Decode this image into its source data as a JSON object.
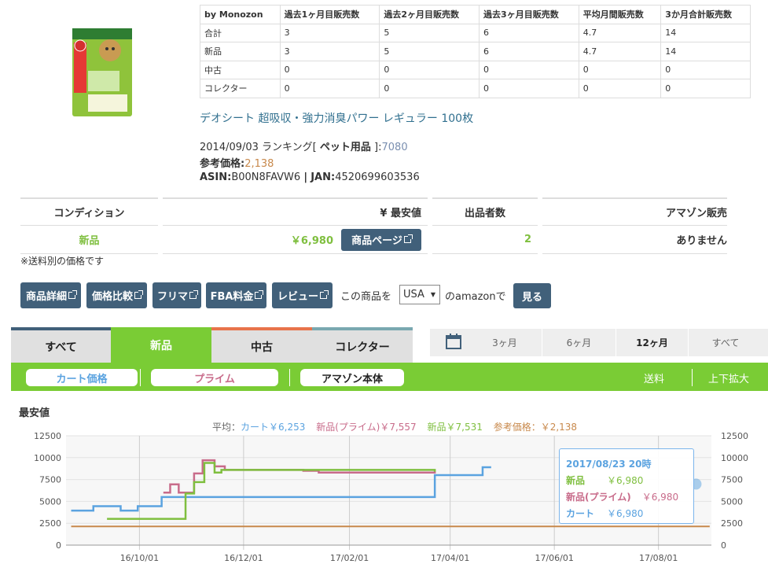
{
  "sales_table": {
    "headers": [
      "by Monozon",
      "過去1ヶ月目販売数",
      "過去2ヶ月目販売数",
      "過去3ヶ月目販売数",
      "平均月間販売数",
      "3か月合計販売数"
    ],
    "rows": [
      [
        "合計",
        "3",
        "5",
        "6",
        "4.7",
        "14"
      ],
      [
        "新品",
        "3",
        "5",
        "6",
        "4.7",
        "14"
      ],
      [
        "中古",
        "0",
        "0",
        "0",
        "0",
        "0"
      ],
      [
        "コレクター",
        "0",
        "0",
        "0",
        "0",
        "0"
      ]
    ]
  },
  "product": {
    "title": "デオシート 超吸収・強力消臭パワー レギュラー 100枚",
    "rank_date": "2014/09/03 ランキング[",
    "rank_category": "ペット用品",
    "rank_close": "]:",
    "rank_value": "7080",
    "ref_price_label": "参考価格:",
    "ref_price": "2,138",
    "asin_label": "ASIN:",
    "asin": "B00N8FAVW6",
    "divider": "|",
    "jan_label": "JAN:",
    "jan": "4520699603536"
  },
  "conditions": {
    "headers": [
      "コンディション",
      "¥ 最安値",
      "出品者数",
      "アマゾン販売"
    ],
    "row": {
      "condition": "新品",
      "price": "￥6,980",
      "page_button": "商品ページ",
      "sellers": "2",
      "amazon": "ありません"
    },
    "note": "※送料別の価格です"
  },
  "actions": {
    "buttons": [
      "商品詳細",
      "価格比較",
      "フリマ",
      "FBA料金",
      "レビュー"
    ],
    "amazon_prefix": "この商品を",
    "country": "USA",
    "amazon_suffix": "のamazonで",
    "view_button": "見る"
  },
  "tabs": [
    "すべて",
    "新品",
    "中古",
    "コレクター"
  ],
  "periods": [
    "3ヶ月",
    "6ヶ月",
    "12ヶ月",
    "すべて"
  ],
  "filters": {
    "cart": "カート価格",
    "prime": "プライム",
    "amazon": "アマゾン本体",
    "shipping": "送料",
    "zoom": "上下拡大"
  },
  "chart_title": "最安値",
  "averages": {
    "label": "平均：",
    "cart": "カート￥6,253",
    "prime": "新品(プライム)￥7,557",
    "new": "新品￥7,531",
    "ref": "参考価格：￥2,138"
  },
  "tooltip": {
    "date": "2017/08/23 20時",
    "new_label": "新品",
    "new_value": "￥6,980",
    "prime_label": "新品(プライム)",
    "prime_value": "￥6,980",
    "cart_label": "カート",
    "cart_value": "￥6,980"
  },
  "colors": {
    "accent": "#41607a",
    "green": "#7acc35",
    "cart": "#5ba3e0",
    "prime": "#c86b8a",
    "new": "#7fbf3f",
    "ref": "#c8894c"
  },
  "chart_data": {
    "type": "line",
    "title": "最安値",
    "ylim": [
      0,
      12500
    ],
    "yticks": [
      "0",
      "2500",
      "5000",
      "7500",
      "10000",
      "12500"
    ],
    "xticks": [
      "16/10/01",
      "16/12/01",
      "17/02/01",
      "17/04/01",
      "17/06/01",
      "17/08/01"
    ],
    "series": [
      {
        "name": "カート",
        "color": "#5ba3e0",
        "points": [
          [
            "2016-08-22",
            3950
          ],
          [
            "2016-09-04",
            4450
          ],
          [
            "2016-09-20",
            3950
          ],
          [
            "2016-09-30",
            4450
          ],
          [
            "2016-10-06",
            4450
          ],
          [
            "2016-10-14",
            5500
          ],
          [
            "2017-03-23",
            8000
          ],
          [
            "2017-04-01",
            8000
          ],
          [
            "2017-04-20",
            8900
          ],
          [
            "2017-04-25",
            8900
          ]
        ]
      },
      {
        "name": "新品(プライム)",
        "color": "#c86b8a",
        "points": [
          [
            "2016-10-15",
            6000
          ],
          [
            "2016-10-19",
            6950
          ],
          [
            "2016-10-24",
            6000
          ],
          [
            "2016-11-02",
            8200
          ],
          [
            "2016-11-07",
            9700
          ],
          [
            "2016-11-14",
            9000
          ],
          [
            "2016-11-20",
            8600
          ],
          [
            "2017-01-05",
            8500
          ],
          [
            "2017-01-14",
            8300
          ],
          [
            "2017-03-23",
            8500
          ]
        ]
      },
      {
        "name": "新品",
        "color": "#7fbf3f",
        "points": [
          [
            "2016-09-12",
            3000
          ],
          [
            "2016-10-28",
            5900
          ],
          [
            "2016-11-02",
            7200
          ],
          [
            "2016-11-08",
            9400
          ],
          [
            "2016-11-14",
            8300
          ],
          [
            "2016-11-18",
            8600
          ],
          [
            "2017-03-23",
            8400
          ]
        ]
      },
      {
        "name": "参考価格",
        "color": "#c8894c",
        "points": [
          [
            "2016-08-22",
            2138
          ],
          [
            "2017-08-31",
            2138
          ]
        ]
      }
    ],
    "grid": true,
    "legend": "none"
  }
}
